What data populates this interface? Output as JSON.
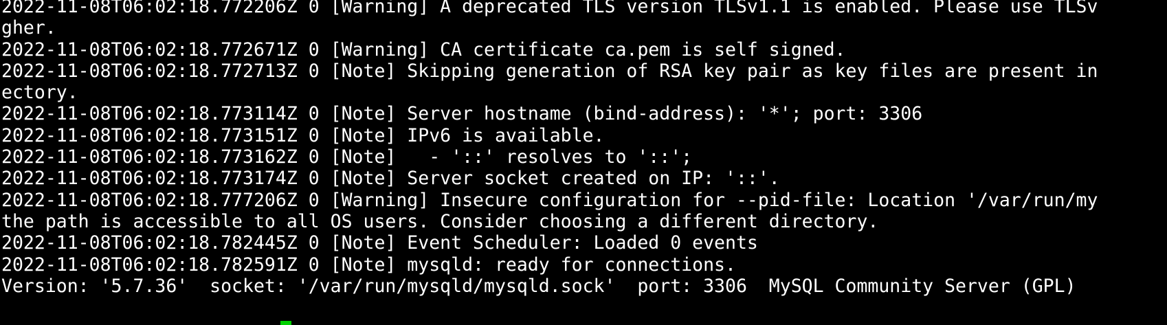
{
  "terminal": {
    "lines": [
      "2022-11-08T06:02:18.772206Z 0 [Warning] A deprecated TLS version TLSv1.1 is enabled. Please use TLSv",
      "gher.",
      "2022-11-08T06:02:18.772671Z 0 [Warning] CA certificate ca.pem is self signed.",
      "2022-11-08T06:02:18.772713Z 0 [Note] Skipping generation of RSA key pair as key files are present in",
      "ectory.",
      "2022-11-08T06:02:18.773114Z 0 [Note] Server hostname (bind-address): '*'; port: 3306",
      "2022-11-08T06:02:18.773151Z 0 [Note] IPv6 is available.",
      "2022-11-08T06:02:18.773162Z 0 [Note]   - '::' resolves to '::';",
      "2022-11-08T06:02:18.773174Z 0 [Note] Server socket created on IP: '::'.",
      "2022-11-08T06:02:18.777206Z 0 [Warning] Insecure configuration for --pid-file: Location '/var/run/my",
      "the path is accessible to all OS users. Consider choosing a different directory.",
      "2022-11-08T06:02:18.782445Z 0 [Note] Event Scheduler: Loaded 0 events",
      "2022-11-08T06:02:18.782591Z 0 [Note] mysqld: ready for connections.",
      "Version: '5.7.36'  socket: '/var/run/mysqld/mysqld.sock'  port: 3306  MySQL Community Server (GPL)"
    ],
    "colors": {
      "background": "#000000",
      "text": "#ffffff",
      "cursor": "#00d000"
    }
  }
}
